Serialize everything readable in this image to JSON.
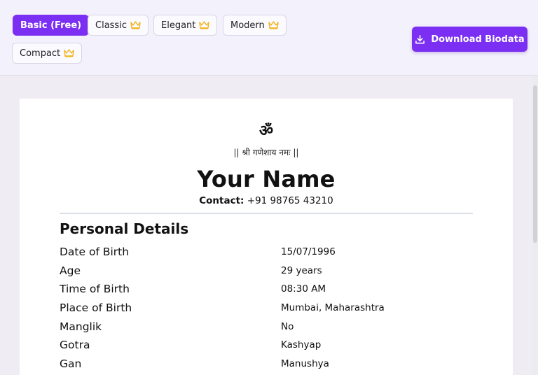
{
  "toolbar": {
    "templates": [
      {
        "label": "Basic (Free)",
        "premium": false,
        "active": true
      },
      {
        "label": "Classic",
        "premium": true,
        "active": false
      },
      {
        "label": "Elegant",
        "premium": true,
        "active": false
      },
      {
        "label": "Modern",
        "premium": true,
        "active": false
      },
      {
        "label": "Compact",
        "premium": true,
        "active": false
      }
    ],
    "download_label": "Download Biodata",
    "accent_color": "#7b2ff2",
    "crown_color": "#f2b31b"
  },
  "biodata": {
    "om": "ॐ",
    "mantra": "|| श्री गणेशाय नमः ||",
    "name": "Your Name",
    "contact_label": "Contact:",
    "contact_value": "+91 98765 43210",
    "section_title": "Personal Details",
    "fields": [
      {
        "label": "Date of Birth",
        "value": "15/07/1996"
      },
      {
        "label": "Age",
        "value": "29 years"
      },
      {
        "label": "Time of Birth",
        "value": "08:30 AM"
      },
      {
        "label": "Place of Birth",
        "value": "Mumbai, Maharashtra"
      },
      {
        "label": "Manglik",
        "value": "No"
      },
      {
        "label": "Gotra",
        "value": "Kashyap"
      },
      {
        "label": "Gan",
        "value": "Manushya"
      }
    ]
  }
}
